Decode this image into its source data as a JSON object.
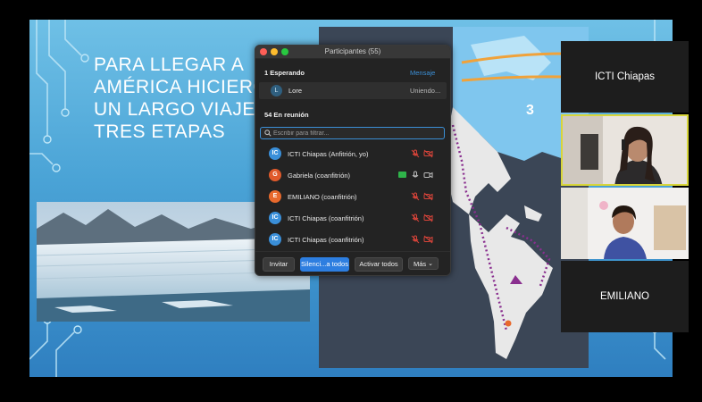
{
  "slide": {
    "title_lines": [
      "PARA LLEGAR A",
      "AMÉRICA HICIERO",
      "UN LARGO VIAJE",
      "TRES ETAPAS"
    ],
    "map_label": "3"
  },
  "participants_panel": {
    "title": "Participantes (55)",
    "waiting_header": "1 Esperando",
    "message_link": "Mensaje",
    "waiting_person": {
      "initial": "L",
      "name": "Lore",
      "status": "Uniendo..."
    },
    "in_meeting_header": "54 En reunión",
    "search_placeholder": "Escribir para filtrar...",
    "participants": [
      {
        "initials": "IC",
        "name": "ICTI Chiapas (Anfitrión, yo)",
        "color": "#3a8fd9",
        "muted": true,
        "video_off": true
      },
      {
        "initials": "G",
        "name": "Gabriela (coanfitrión)",
        "color": "#e05a2b",
        "muted": false,
        "video_off": false,
        "sharing": true
      },
      {
        "initials": "E",
        "name": "EMILIANO (coanfitrión)",
        "color": "#e8692c",
        "muted": true,
        "video_off": true
      },
      {
        "initials": "IC",
        "name": "ICTI Chiapas (coanfitrión)",
        "color": "#3a8fd9",
        "muted": true,
        "video_off": true
      },
      {
        "initials": "IC",
        "name": "ICTI Chiapas (coanfitrión)",
        "color": "#3a8fd9",
        "muted": true,
        "video_off": true
      }
    ],
    "footer": {
      "invite": "Invitar",
      "mute_all": "Silenci...a todos",
      "unmute_all": "Activar todos",
      "more": "Más"
    }
  },
  "video_tiles": [
    {
      "name": "ICTI Chiapas",
      "has_video": false
    },
    {
      "name": "",
      "has_video": true,
      "active_speaker": true
    },
    {
      "name": "",
      "has_video": true
    },
    {
      "name": "EMILIANO",
      "has_video": false
    }
  ],
  "colors": {
    "accent": "#3b8fd6",
    "mute_red": "#d9443a",
    "active_speaker": "#d7d53a",
    "slide_blue": "#4aa3d6",
    "route_purple": "#8a2f8f",
    "arrow_orange": "#f0a23a"
  }
}
